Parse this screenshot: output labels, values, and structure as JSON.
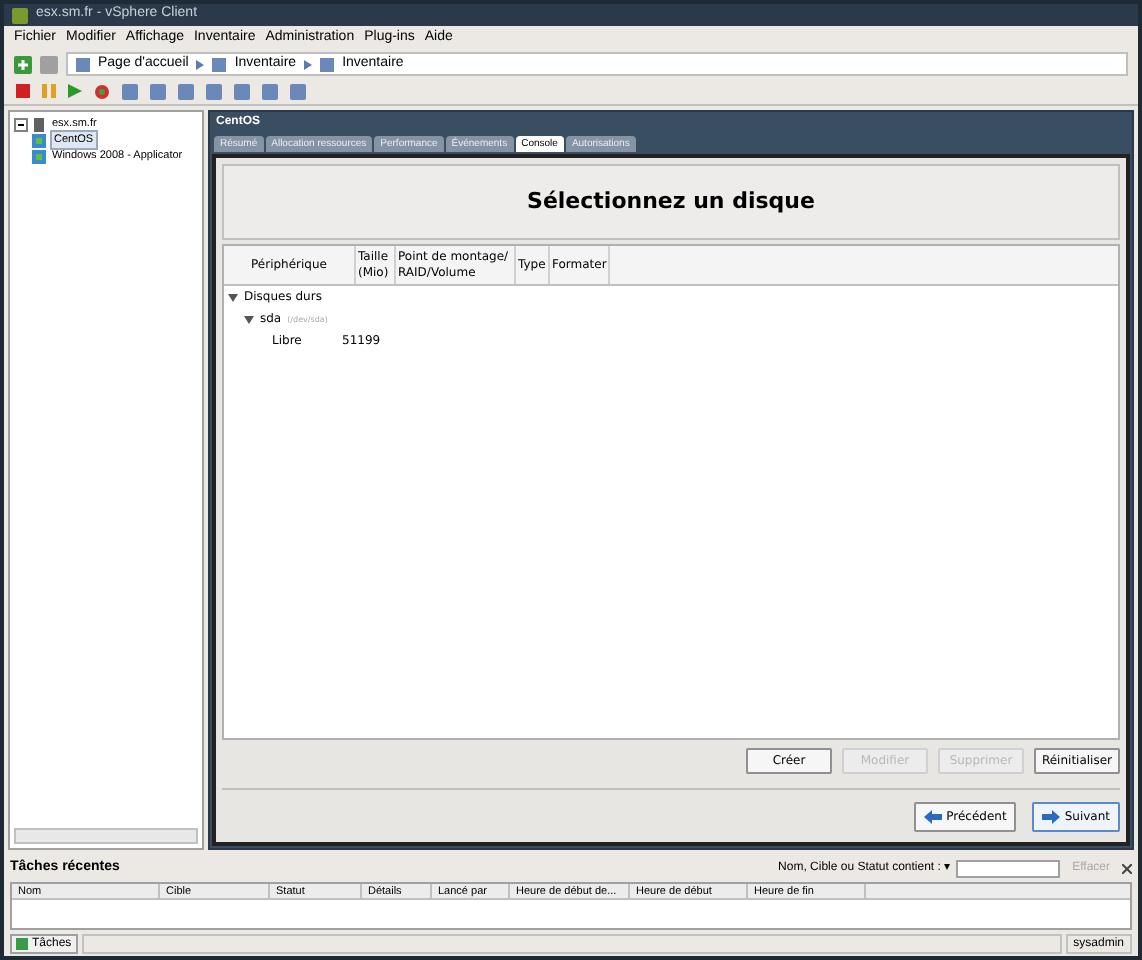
{
  "window": {
    "title": "esx.sm.fr - vSphere Client"
  },
  "menu": [
    "Fichier",
    "Modifier",
    "Affichage",
    "Inventaire",
    "Administration",
    "Plug-ins",
    "Aide"
  ],
  "breadcrumb": [
    "Page d'accueil",
    "Inventaire",
    "Inventaire"
  ],
  "tree": [
    {
      "label": "esx.sm.fr",
      "expanded": true,
      "children": [
        {
          "label": "CentOS",
          "selected": true
        },
        {
          "label": "Windows 2008 - Applicator",
          "selected": false
        }
      ]
    }
  ],
  "vm_title": "CentOS",
  "tabs": [
    {
      "label": "Résumé",
      "selected": false
    },
    {
      "label": "Allocation ressources",
      "selected": false
    },
    {
      "label": "Performance",
      "selected": false
    },
    {
      "label": "Événements",
      "selected": false
    },
    {
      "label": "Console",
      "selected": true
    },
    {
      "label": "Autorisations",
      "selected": false
    }
  ],
  "console": {
    "heading": "Sélectionnez un disque",
    "columns": [
      "Périphérique",
      "Taille\n(Mio)",
      "Point de montage/\nRAID/Volume",
      "Type",
      "Formater"
    ],
    "rows": [
      {
        "label": "Disques durs",
        "expanded": true,
        "children": [
          {
            "label": "sda",
            "note": "(/dev/sda)",
            "expanded": true,
            "children": [
              {
                "label": "Libre",
                "size": "51199"
              }
            ]
          }
        ]
      }
    ],
    "buttons": [
      {
        "label": "Créer",
        "disabled": false
      },
      {
        "label": "Modifier",
        "disabled": true
      },
      {
        "label": "Supprimer",
        "disabled": true
      },
      {
        "label": "Réinitialiser",
        "disabled": false
      }
    ],
    "nav": [
      {
        "label": "Précédent",
        "kind": "back"
      },
      {
        "label": "Suivant",
        "kind": "next"
      }
    ]
  },
  "recent_tasks": {
    "title": "Tâches récentes",
    "filter_label": "Nom, Cible ou Statut contient : ▾",
    "clear": "Effacer",
    "columns": [
      "Nom",
      "Cible",
      "Statut",
      "Détails",
      "Lancé par",
      "Heure de début de...",
      "Heure de début",
      "Heure de fin"
    ]
  },
  "status_bar": {
    "tasks": "Tâches",
    "user": "sysadmin"
  }
}
